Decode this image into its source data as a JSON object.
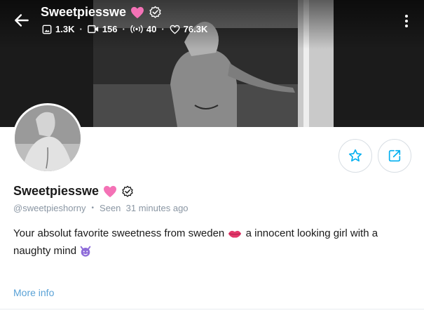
{
  "header": {
    "display_name": "Sweetpiesswe",
    "stats": {
      "photos": "1.3K",
      "videos": "156",
      "streams": "40",
      "likes": "76.3K"
    }
  },
  "profile": {
    "display_name": "Sweetpiesswe",
    "handle": "@sweetpieshorny",
    "seen_text": "Seen  31 minutes ago",
    "bio_line_1": "Your absolut favorite sweetness from sweden",
    "bio_line_1_end": " a innocent looking girl with a",
    "bio_line_2": "naughty mind",
    "more_info_label": "More info"
  },
  "icons": {
    "back": "arrow-left-icon",
    "heart": "heart-emoji-icon",
    "verified": "verified-badge-icon",
    "photo": "image-icon",
    "video": "video-icon",
    "stream": "broadcast-icon",
    "like": "heart-outline-icon",
    "more": "more-vertical-icon",
    "favorite": "star-icon",
    "share": "share-icon",
    "kiss": "lips-emoji-icon",
    "devil": "devil-emoji-icon"
  },
  "colors": {
    "accent": "#00aff0",
    "heart_pink": "#f472b6",
    "muted_text": "#8a96a3",
    "link": "#5aa2d6"
  }
}
